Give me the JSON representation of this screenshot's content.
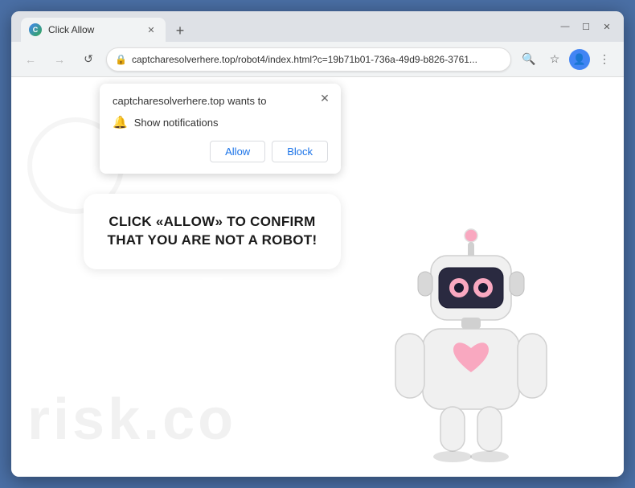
{
  "browser": {
    "title": "Click Allow",
    "favicon": "C",
    "url": "captcharesolverhere.top/robot4/index.html?c=19b71b01-736a-49d9-b826-3761...",
    "new_tab_icon": "+",
    "window_controls": {
      "minimize": "—",
      "maximize": "☐",
      "close": "✕"
    },
    "nav": {
      "back": "←",
      "forward": "→",
      "reload": "↺"
    },
    "toolbar_icons": {
      "search": "🔍",
      "bookmark": "☆",
      "profile": "👤",
      "menu": "⋮"
    }
  },
  "notification_popup": {
    "title": "captcharesolverhere.top wants to",
    "permission": "Show notifications",
    "close_icon": "✕",
    "bell_icon": "🔔",
    "allow_label": "Allow",
    "block_label": "Block"
  },
  "page": {
    "bubble_text": "CLICK «ALLOW» TO CONFIRM THAT YOU ARE NOT A ROBOT!",
    "watermark": "risk.co"
  },
  "colors": {
    "browser_bg": "#dee1e6",
    "tab_active": "#f1f3f4",
    "allow_btn_color": "#1a73e8",
    "block_btn_color": "#1a73e8",
    "bubble_bg": "#ffffff",
    "accent": "#4a6fa5"
  }
}
